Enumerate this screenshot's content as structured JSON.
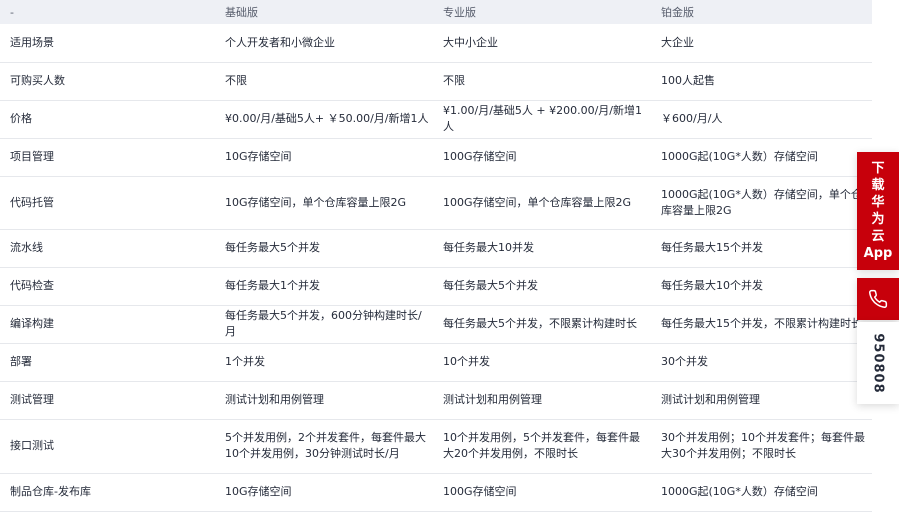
{
  "table": {
    "headers": [
      "-",
      "基础版",
      "专业版",
      "铂金版"
    ],
    "rows": [
      {
        "feature": "适用场景",
        "basic": "个人开发者和小微企业",
        "pro": "大中小企业",
        "platinum": "大企业"
      },
      {
        "feature": "可购买人数",
        "basic": "不限",
        "pro": "不限",
        "platinum": "100人起售"
      },
      {
        "feature": "价格",
        "basic": "¥0.00/月/基础5人+ ￥50.00/月/新增1人",
        "pro": "¥1.00/月/基础5人 + ¥200.00/月/新增1人",
        "platinum": "￥600/月/人"
      },
      {
        "feature": "项目管理",
        "basic": "10G存储空间",
        "pro": "100G存储空间",
        "platinum": "1000G起(10G*人数）存储空间"
      },
      {
        "feature": "代码托管",
        "basic": "10G存储空间，单个仓库容量上限2G",
        "pro": "100G存储空间，单个仓库容量上限2G",
        "platinum": "1000G起(10G*人数）存储空间，单个仓库容量上限2G"
      },
      {
        "feature": "流水线",
        "basic": "每任务最大5个并发",
        "pro": "每任务最大10并发",
        "platinum": "每任务最大15个并发"
      },
      {
        "feature": "代码检查",
        "basic": "每任务最大1个并发",
        "pro": "每任务最大5个并发",
        "platinum": "每任务最大10个并发"
      },
      {
        "feature": "编译构建",
        "basic": "每任务最大5个并发，600分钟构建时长/月",
        "pro": "每任务最大5个并发，不限累计构建时长",
        "platinum": "每任务最大15个并发，不限累计构建时长"
      },
      {
        "feature": "部署",
        "basic": "1个并发",
        "pro": "10个并发",
        "platinum": "30个并发"
      },
      {
        "feature": "测试管理",
        "basic": "测试计划和用例管理",
        "pro": "测试计划和用例管理",
        "platinum": "测试计划和用例管理"
      },
      {
        "feature": "接口测试",
        "basic": "5个并发用例，2个并发套件，每套件最大10个并发用例，30分钟测试时长/月",
        "pro": "10个并发用例，5个并发套件，每套件最大20个并发用例，不限时长",
        "platinum": "30个并发用例；10个并发套件；每套件最大30个并发用例；不限时长"
      },
      {
        "feature": "制品仓库-发布库",
        "basic": "10G存储空间",
        "pro": "100G存储空间",
        "platinum": "1000G起(10G*人数）存储空间"
      }
    ]
  },
  "side": {
    "download_chars": [
      "下",
      "载",
      "华",
      "为",
      "云",
      "App"
    ],
    "phone_icon": "phone-icon",
    "hotline": "950808",
    "accent": "#c7000b"
  }
}
